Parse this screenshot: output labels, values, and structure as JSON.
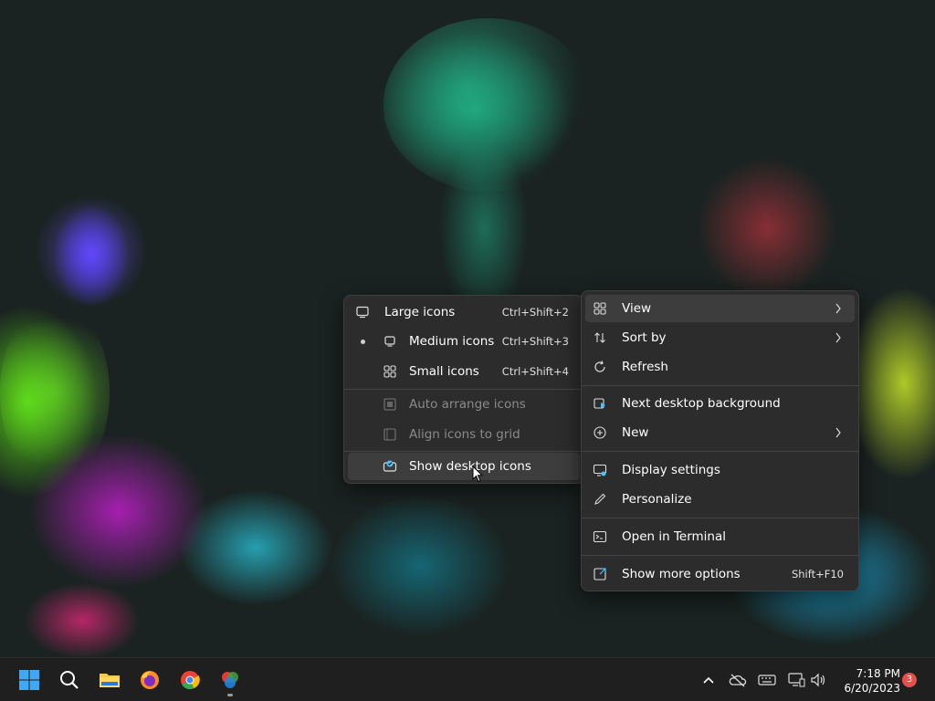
{
  "view_submenu": {
    "items": [
      {
        "label": "Large icons",
        "shortcut": "Ctrl+Shift+2",
        "icon": "monitor-large-icon",
        "selected": false
      },
      {
        "label": "Medium icons",
        "shortcut": "Ctrl+Shift+3",
        "icon": "monitor-medium-icon",
        "selected": true
      },
      {
        "label": "Small icons",
        "shortcut": "Ctrl+Shift+4",
        "icon": "grid-small-icon",
        "selected": false
      },
      {
        "label": "Auto arrange icons",
        "icon": "auto-arrange-icon",
        "disabled": true
      },
      {
        "label": "Align icons to grid",
        "icon": "align-grid-icon",
        "disabled": true
      },
      {
        "label": "Show desktop icons",
        "icon": "show-desktop-icon",
        "highlighted": true
      }
    ]
  },
  "context_menu": {
    "items": [
      {
        "label": "View",
        "icon": "grid-view-icon",
        "submenu": true,
        "highlighted": true
      },
      {
        "label": "Sort by",
        "icon": "sort-icon",
        "submenu": true
      },
      {
        "label": "Refresh",
        "icon": "refresh-icon"
      },
      {
        "label": "Next desktop background",
        "icon": "next-background-icon"
      },
      {
        "label": "New",
        "icon": "new-plus-icon",
        "submenu": true
      },
      {
        "label": "Display settings",
        "icon": "display-settings-icon"
      },
      {
        "label": "Personalize",
        "icon": "pen-icon"
      },
      {
        "label": "Open in Terminal",
        "icon": "terminal-icon"
      },
      {
        "label": "Show more options",
        "shortcut": "Shift+F10",
        "icon": "more-options-icon"
      }
    ]
  },
  "taskbar": {
    "apps": [
      "start-icon",
      "search-icon",
      "file-explorer-icon",
      "firefox-icon",
      "chrome-icon",
      "photos-app-icon"
    ],
    "tray": [
      "chevron-up-icon",
      "onedrive-icon",
      "keyboard-icon",
      "network-icon",
      "volume-icon"
    ],
    "time": "7:18 PM",
    "date": "6/20/2023",
    "notification_count": "3"
  },
  "colors": {
    "menu_bg": "#2c2c2c",
    "menu_highlight": "#3d3d3d",
    "taskbar_bg": "#1f1f1f",
    "badge": "#e5504a",
    "accent": "#4cc2ff"
  }
}
